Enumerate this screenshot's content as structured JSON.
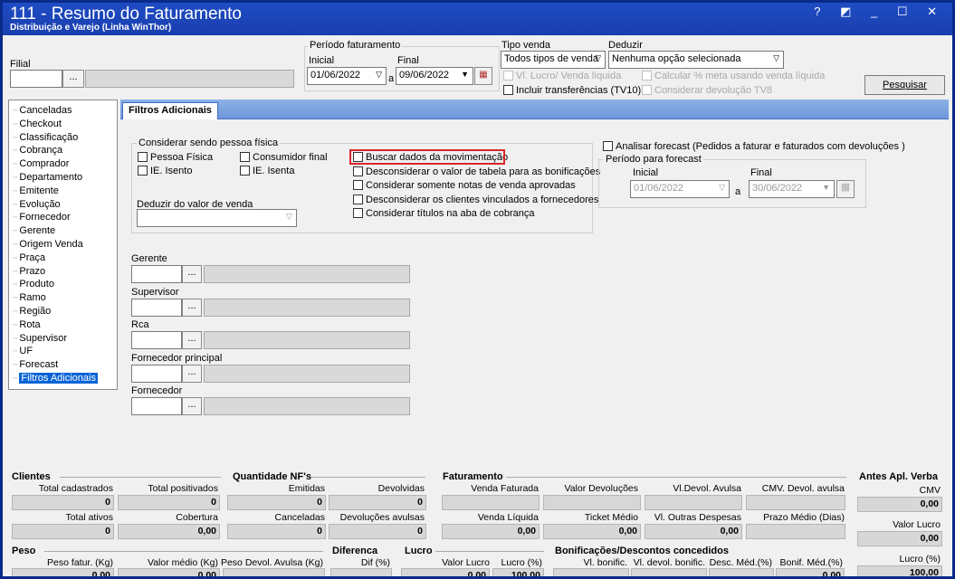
{
  "window": {
    "title": "111 - Resumo do Faturamento",
    "subtitle": "Distribuição e Varejo (Linha WinThor)",
    "controls": "? ◩ _ ☐ ✕"
  },
  "filial": {
    "label": "Filial",
    "browse": "..."
  },
  "periodo": {
    "label": "Período faturamento",
    "inicial_label": "Inicial",
    "inicial": "01/06/2022",
    "a": "a",
    "final_label": "Final",
    "final": "09/06/2022"
  },
  "tipo_venda": {
    "label": "Tipo venda",
    "value": "Todos tipos de venda"
  },
  "deduzir": {
    "label": "Deduzir",
    "value": "Nenhuma opção selecionada"
  },
  "top_checks": {
    "vl_lucro": "Vl. Lucro/ Venda líquida",
    "calcular": "Calcular % meta usando venda líquida",
    "incluir": "Incluir transferências  (TV10)",
    "considerar_dev": "Considerar devolução TV8"
  },
  "pesquisar": "Pesquisar",
  "tree": [
    "Canceladas",
    "Checkout",
    "Classificação",
    "Cobrança",
    "Comprador",
    "Departamento",
    "Emitente",
    "Evolução",
    "Fornecedor",
    "Gerente",
    "Origem Venda",
    "Praça",
    "Prazo",
    "Produto",
    "Ramo",
    "Região",
    "Rota",
    "Supervisor",
    "UF",
    "Forecast",
    "Filtros Adicionais"
  ],
  "tab": "Filtros Adicionais",
  "pessoa": {
    "label": "Considerar sendo pessoa física",
    "pf": "Pessoa Física",
    "cf": "Consumidor final",
    "ie1": "IE. Isento",
    "ie2": "IE. Isenta",
    "deduzir_label": "Deduzir do valor de venda"
  },
  "options": [
    "Buscar dados da movimentação",
    "Desconsiderar o valor de tabela para as bonificações",
    "Considerar somente notas de venda aprovadas",
    "Desconsiderar os clientes vinculados a fornecedores",
    "Considerar títulos na aba de cobrança"
  ],
  "forecast": {
    "check": "Analisar forecast (Pedidos a faturar e faturados com devoluções )",
    "periodo": "Período para forecast",
    "inicial_label": "Inicial",
    "inicial": "01/06/2022",
    "a": "a",
    "final_label": "Final",
    "final": "30/06/2022"
  },
  "filters": [
    "Gerente",
    "Supervisor",
    "Rca",
    "Fornecedor principal",
    "Fornecedor"
  ],
  "footer": {
    "clientes": {
      "title": "Clientes",
      "total_cad": "Total cadastrados",
      "total_pos": "Total positivados",
      "v1": "0",
      "v2": "0",
      "total_ativos": "Total ativos",
      "cobertura": "Cobertura",
      "v3": "0",
      "v4": "0,00"
    },
    "qtd": {
      "title": "Quantidade NF's",
      "emitidas": "Emitidas",
      "devolvidas": "Devolvidas",
      "v1": "0",
      "v2": "0",
      "canceladas": "Canceladas",
      "dev_avulsas": "Devoluções avulsas",
      "v3": "0",
      "v4": "0"
    },
    "fat": {
      "title": "Faturamento",
      "venda_fat": "Venda Faturada",
      "valor_dev": "Valor Devoluções",
      "vl_dev_avulsa": "Vl.Devol. Avulsa",
      "cmv_dev": "CMV. Devol. avulsa",
      "venda_liq": "Venda Líquida",
      "ticket": "Ticket Médio",
      "outras": "Vl. Outras Despesas",
      "prazo": "Prazo Médio (Dias)",
      "v1": "0,00",
      "v2": "0,00",
      "v3": "0,00"
    },
    "antes": {
      "title": "Antes Apl. Verba",
      "cmv": "CMV",
      "v1": "0,00",
      "valor_lucro": "Valor Lucro",
      "v2": "0,00",
      "lucro": "Lucro (%)",
      "v3": "100,00"
    },
    "peso": {
      "title": "Peso",
      "fatur": "Peso fatur. (Kg)",
      "medio": "Valor médio (Kg)",
      "devol": "Peso Devol. Avulsa (Kg)",
      "v1": "0,00",
      "v2": "0,00"
    },
    "dif": {
      "title": "Diferenca",
      "label": "Dif (%)"
    },
    "lucro": {
      "title": "Lucro",
      "valor": "Valor Lucro",
      "pct": "Lucro (%)",
      "v1": "0,00",
      "v2": "100,00"
    },
    "bonif": {
      "title": "Bonificações/Descontos concedidos",
      "vl": "Vl. bonific.",
      "vl_dev": "Vl. devol. bonific.",
      "desc": "Desc. Méd.(%)",
      "bmed": "Bonif. Méd.(%)",
      "v1": "0,00"
    }
  }
}
